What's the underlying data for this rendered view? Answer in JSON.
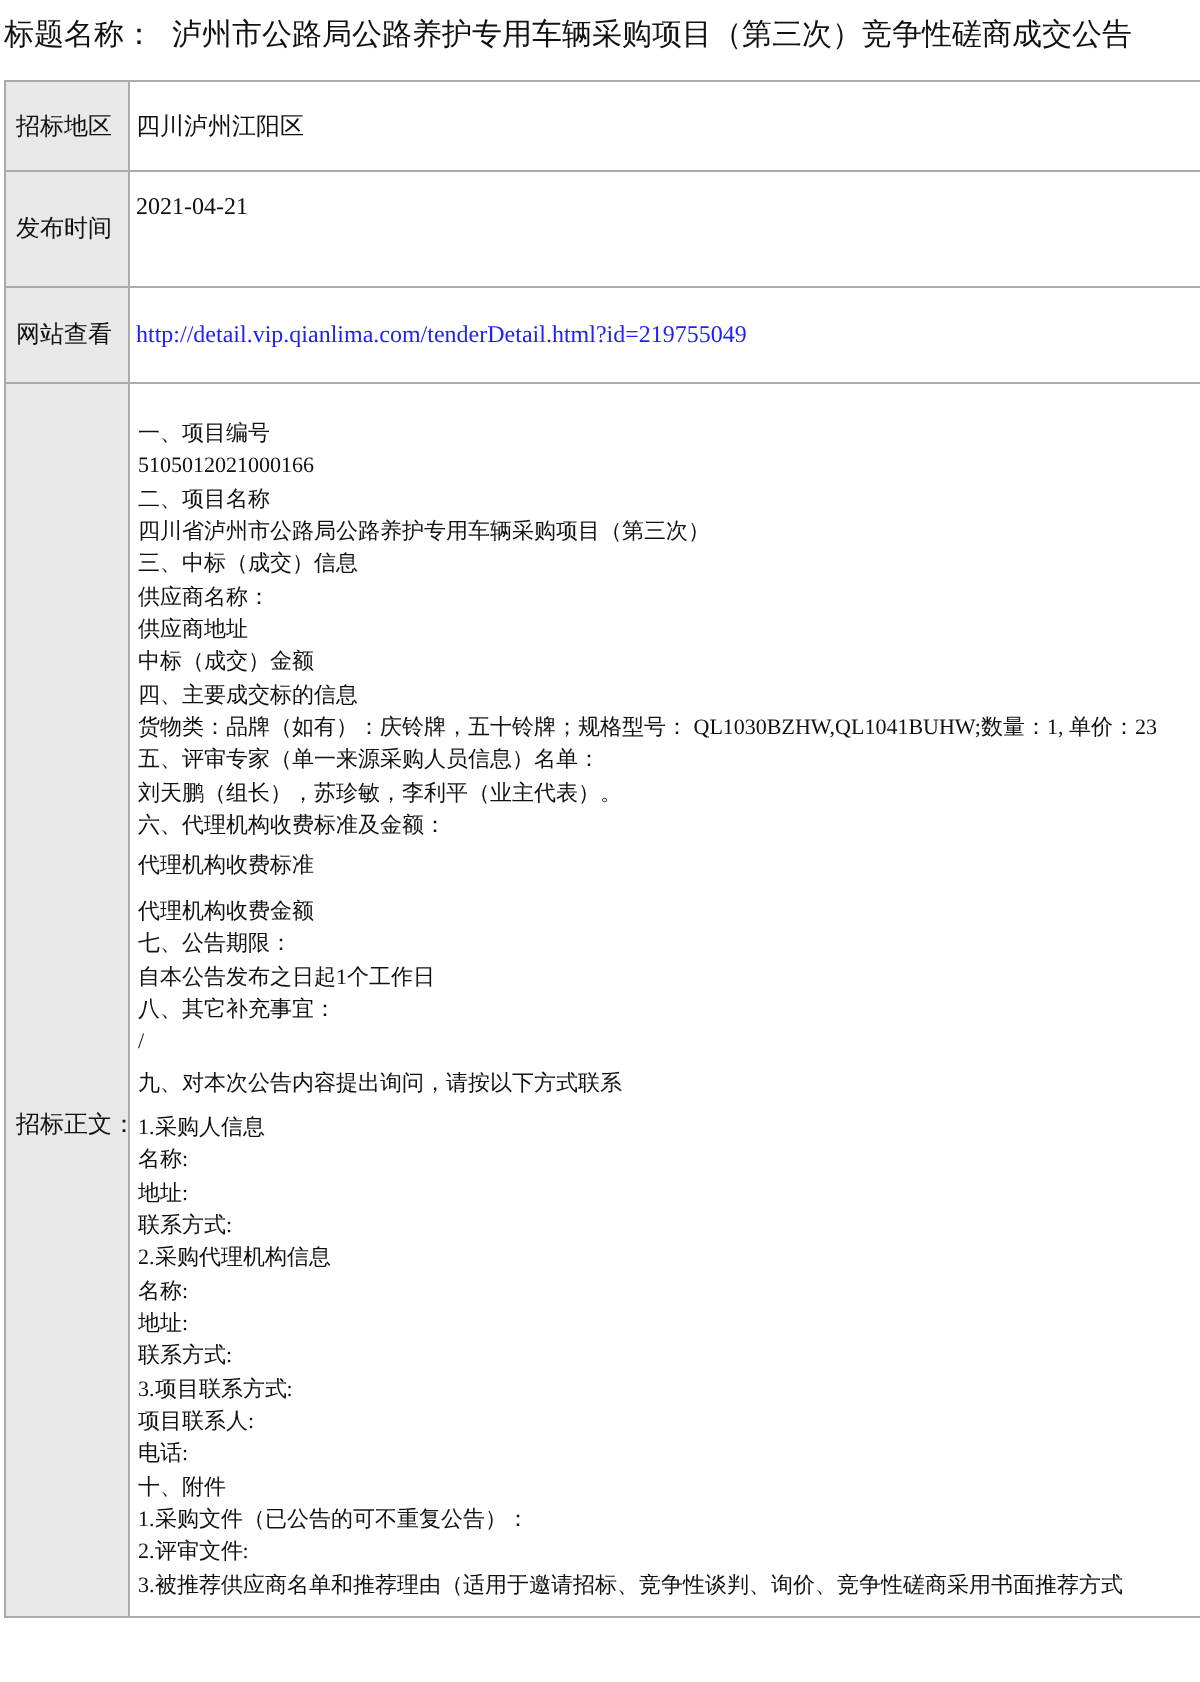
{
  "header": {
    "label": "标题名称：",
    "title": "泸州市公路局公路养护专用车辆采购项目（第三次）竞争性磋商成交公告"
  },
  "fields": [
    {
      "label": "招标地区",
      "value": "四川泸州江阳区",
      "kind": "text"
    },
    {
      "label": "发布时间",
      "value": "2021-04-21",
      "kind": "date"
    },
    {
      "label": "网站查看",
      "value": "http://detail.vip.qianlima.com/tenderDetail.html?id=219755049",
      "kind": "link"
    }
  ],
  "body": {
    "label": "招标正文：",
    "lines": [
      {
        "text": "一、项目编号",
        "kind": "line"
      },
      {
        "text": "5105012021000166",
        "kind": "line"
      },
      {
        "text": "二、项目名称",
        "kind": "line"
      },
      {
        "text": "四川省泸州市公路局公路养护专用车辆采购项目（第三次）",
        "kind": "line"
      },
      {
        "text": "三、中标（成交）信息",
        "kind": "line"
      },
      {
        "text": "供应商名称：",
        "kind": "line"
      },
      {
        "text": "供应商地址",
        "kind": "line"
      },
      {
        "text": "中标（成交）金额",
        "kind": "line"
      },
      {
        "text": "四、主要成交标的信息",
        "kind": "line"
      },
      {
        "text": "货物类：品牌（如有）：庆铃牌，五十铃牌；规格型号： QL1030BZHW,QL1041BUHW;数量：1, 单价：23",
        "kind": "line"
      },
      {
        "text": "五、评审专家（单一来源采购人员信息）名单：",
        "kind": "line"
      },
      {
        "text": "刘天鹏（组长），苏珍敏，李利平（业主代表）。",
        "kind": "line"
      },
      {
        "text": "六、代理机构收费标准及金额：",
        "kind": "line"
      },
      {
        "text": "代理机构收费标准",
        "kind": "para"
      },
      {
        "text": "代理机构收费金额",
        "kind": "line"
      },
      {
        "text": "七、公告期限：",
        "kind": "line"
      },
      {
        "text": "自本公告发布之日起1个工作日",
        "kind": "line"
      },
      {
        "text": "八、其它补充事宜：",
        "kind": "line"
      },
      {
        "text": "/",
        "kind": "line"
      },
      {
        "text": "九、对本次公告内容提出询问，请按以下方式联系",
        "kind": "para"
      },
      {
        "text": "1.采购人信息",
        "kind": "line"
      },
      {
        "text": "名称:",
        "kind": "line"
      },
      {
        "text": "地址:",
        "kind": "line"
      },
      {
        "text": "联系方式:",
        "kind": "line"
      },
      {
        "text": "2.采购代理机构信息",
        "kind": "line"
      },
      {
        "text": "名称:",
        "kind": "line"
      },
      {
        "text": "地址:",
        "kind": "line"
      },
      {
        "text": "联系方式:",
        "kind": "line"
      },
      {
        "text": "3.项目联系方式:",
        "kind": "line"
      },
      {
        "text": "项目联系人:",
        "kind": "line"
      },
      {
        "text": "电话:",
        "kind": "line"
      },
      {
        "text": "十、附件",
        "kind": "line"
      },
      {
        "text": "1.采购文件（已公告的可不重复公告）：",
        "kind": "line"
      },
      {
        "text": "2.评审文件:",
        "kind": "line"
      },
      {
        "text": "3.被推荐供应商名单和推荐理由（适用于邀请招标、竞争性谈判、询价、竞争性磋商采用书面推荐方式",
        "kind": "line"
      }
    ]
  }
}
